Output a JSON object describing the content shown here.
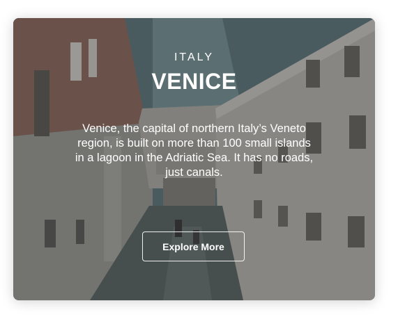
{
  "card": {
    "subtitle": "ITALY",
    "title": "VENICE",
    "description": "Venice, the capital of northern Italy’s Veneto region, is built on more than 100 small islands in a lagoon in the Adriatic Sea. It has no roads, just canals.",
    "button_label": "Explore More"
  },
  "colors": {
    "overlay": "#303030",
    "text": "#ffffff",
    "button_border": "#ffffff"
  }
}
